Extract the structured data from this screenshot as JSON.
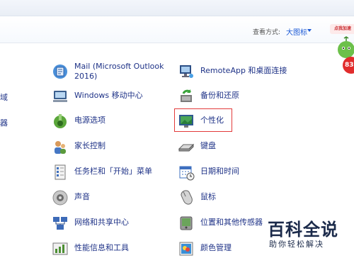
{
  "header": {
    "view_by_label": "查看方式:",
    "view_by_value": "大图标"
  },
  "left_edge_partial": {
    "label_1": "域",
    "label_2": "器"
  },
  "items_left": [
    {
      "label": "Mail (Microsoft Outlook 2016)",
      "icon": "mail-icon"
    },
    {
      "label": "Windows 移动中心",
      "icon": "mobility-center-icon"
    },
    {
      "label": "电源选项",
      "icon": "power-options-icon"
    },
    {
      "label": "家长控制",
      "icon": "parental-controls-icon"
    },
    {
      "label": "任务栏和「开始」菜单",
      "icon": "taskbar-icon"
    },
    {
      "label": "声音",
      "icon": "sound-icon"
    },
    {
      "label": "网络和共享中心",
      "icon": "network-icon"
    },
    {
      "label": "性能信息和工具",
      "icon": "performance-icon"
    }
  ],
  "items_right": [
    {
      "label": "RemoteApp 和桌面连接",
      "icon": "remoteapp-icon"
    },
    {
      "label": "备份和还原",
      "icon": "backup-icon"
    },
    {
      "label": "个性化",
      "icon": "personalization-icon"
    },
    {
      "label": "键盘",
      "icon": "keyboard-icon"
    },
    {
      "label": "日期和时间",
      "icon": "datetime-icon"
    },
    {
      "label": "鼠标",
      "icon": "mouse-icon"
    },
    {
      "label": "位置和其他传感器",
      "icon": "location-sensors-icon"
    },
    {
      "label": "颜色管理",
      "icon": "color-management-icon"
    }
  ],
  "overlay": {
    "badge_text": "点我加速",
    "percent_text": "83"
  },
  "watermark": {
    "main": "百科全说",
    "sub": "助你轻松解决"
  },
  "colors": {
    "link": "#1e3287",
    "highlight": "#e23a3a"
  }
}
